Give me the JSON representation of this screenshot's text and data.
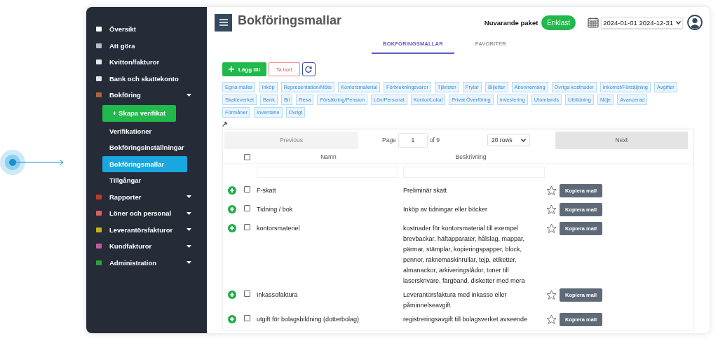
{
  "sidebar": {
    "items": [
      {
        "label": "Översikt",
        "color": "#ffffff",
        "kind": "link"
      },
      {
        "label": "Att göra",
        "color": "#b8bcc6",
        "kind": "link"
      },
      {
        "label": "Kvitton/fakturor",
        "color": "#e8e8e8",
        "kind": "link"
      },
      {
        "label": "Bank och skattekonto",
        "color": "#e8e8e8",
        "kind": "link"
      },
      {
        "label": "Bokföring",
        "color": "#b0643a",
        "kind": "group",
        "children": [
          {
            "label": "+ Skapa verifikat",
            "kind": "button"
          },
          {
            "label": "Verifikationer",
            "kind": "link",
            "selected": false
          },
          {
            "label": "Bokföringsinställningar",
            "kind": "link",
            "selected": false
          },
          {
            "label": "Bokföringsmallar",
            "kind": "link",
            "selected": true
          },
          {
            "label": "Tillgångar",
            "kind": "link",
            "selected": false
          }
        ]
      },
      {
        "label": "Rapporter",
        "color": "#c0392b",
        "kind": "group"
      },
      {
        "label": "Löner och personal",
        "color": "#e06060",
        "kind": "group"
      },
      {
        "label": "Leverantörsfakturor",
        "color": "#c9b21a",
        "kind": "group"
      },
      {
        "label": "Kundfakturor",
        "color": "#c45aa8",
        "kind": "group"
      },
      {
        "label": "Administration",
        "color": "#2e9e3e",
        "kind": "group"
      }
    ]
  },
  "header": {
    "title": "Bokföringsmallar",
    "package_label": "Nuvarande paket",
    "package": "Enklast",
    "date_range": "2024-01-01 2024-12-31"
  },
  "tabs": [
    {
      "label": "BOKFÖRINGSMALLAR",
      "selected": true
    },
    {
      "label": "FAVORITER",
      "selected": false
    }
  ],
  "toolbar": {
    "add": "Lägg till",
    "remove": "Ta bort"
  },
  "tags": [
    "Egna mallar",
    "Inköp",
    "Representation/Möte",
    "Kontorsmaterial",
    "Förbrukningsvaror",
    "Tjänster",
    "Prylar",
    "Biljetter",
    "Abonnemang",
    "Övriga kostnader",
    "Inkomst/Försäljning",
    "Avgifter",
    "Skatteverket",
    "Bank",
    "Bil",
    "Resa",
    "Försäkring/Pension",
    "Lön/Personal",
    "Kontor/Lokal",
    "Privat Överföring",
    "Investering",
    "Utomlands",
    "Utbildning",
    "Nöje",
    "Avancerad",
    "Förmåner",
    "Inventarie",
    "Övrigt"
  ],
  "pager": {
    "previous": "Previous",
    "page_label": "Page",
    "page": "1",
    "of": "of 9",
    "rows": "20 rows",
    "next": "Next"
  },
  "table": {
    "columns": [
      "Namn",
      "Beskrivning"
    ],
    "all_checked": false,
    "rows": [
      {
        "name": "F-skatt",
        "description": "Preliminär skatt",
        "checked": false,
        "favorite": false,
        "action": "Kopiera mall"
      },
      {
        "name": "Tidning / bok",
        "description": "Inköp av tidningar eller böcker",
        "checked": false,
        "favorite": false,
        "action": "Kopiera mall"
      },
      {
        "name": "kontorsmateriel",
        "description": "kostnader för kontorsmaterial till exempel brevbackar, häftapparater, hålslag, mappar, pärmar, stämplar, kopieringspapper, block, pennor, räknemaskinrullar, tejp, etiketter, almanackor, arkiveringslådor, toner till laserskrivare, färgband, disketter med mera",
        "checked": false,
        "favorite": false,
        "action": "Kopiera mall"
      },
      {
        "name": "Inkassofaktura",
        "description": "Leverantörsfaktura med inkasso eller påminnelseavgift",
        "checked": false,
        "favorite": false,
        "action": "Kopiera mall"
      },
      {
        "name": "utgift för bolagsbildning (dotterbolag)",
        "description": "registreringsavgift till bolagsverket avseende",
        "checked": false,
        "favorite": false,
        "action": "Kopiera mall"
      }
    ]
  }
}
